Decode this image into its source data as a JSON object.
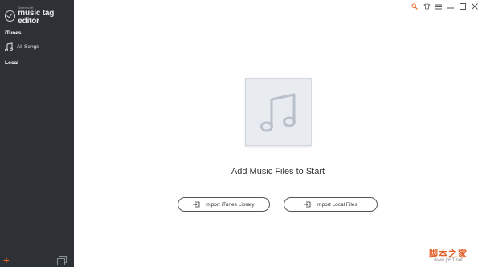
{
  "app": {
    "brand_small": "Sweetsoft",
    "brand_name": "music tag editor"
  },
  "sidebar": {
    "sections": [
      {
        "label": "iTunes",
        "items": [
          {
            "label": "All Songs"
          }
        ]
      },
      {
        "label": "Local",
        "items": []
      }
    ]
  },
  "window_controls": [
    "search-icon",
    "skin-icon",
    "menu-icon",
    "minimize-icon",
    "maximize-icon",
    "close-icon"
  ],
  "main": {
    "headline": "Add Music Files to Start",
    "import_itunes_label": "Import iTunes Library",
    "import_local_label": "Import Local Files"
  },
  "watermark": {
    "text": "脚本之家",
    "url": "www.jb51.net"
  },
  "colors": {
    "sidebar_bg": "#2d3136",
    "accent": "#f26522",
    "art_bg": "#e8ebf0"
  }
}
